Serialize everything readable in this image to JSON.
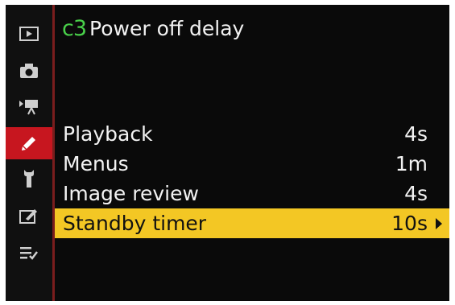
{
  "header": {
    "code": "c3",
    "title": "Power off delay"
  },
  "sidebar": {
    "items": [
      {
        "icon": "playback-icon"
      },
      {
        "icon": "camera-icon"
      },
      {
        "icon": "movie-icon"
      },
      {
        "icon": "pencil-icon",
        "active": true
      },
      {
        "icon": "wrench-icon"
      },
      {
        "icon": "retouch-icon"
      },
      {
        "icon": "my-menu-icon"
      }
    ]
  },
  "menu": {
    "items": [
      {
        "label": "Playback",
        "value": "4s"
      },
      {
        "label": "Menus",
        "value": "1m"
      },
      {
        "label": "Image review",
        "value": "4s"
      },
      {
        "label": "Standby timer",
        "value": "10s",
        "selected": true
      }
    ]
  },
  "colors": {
    "accent_green": "#49d14a",
    "highlight_yellow": "#f3c724",
    "active_red": "#c7161f"
  }
}
